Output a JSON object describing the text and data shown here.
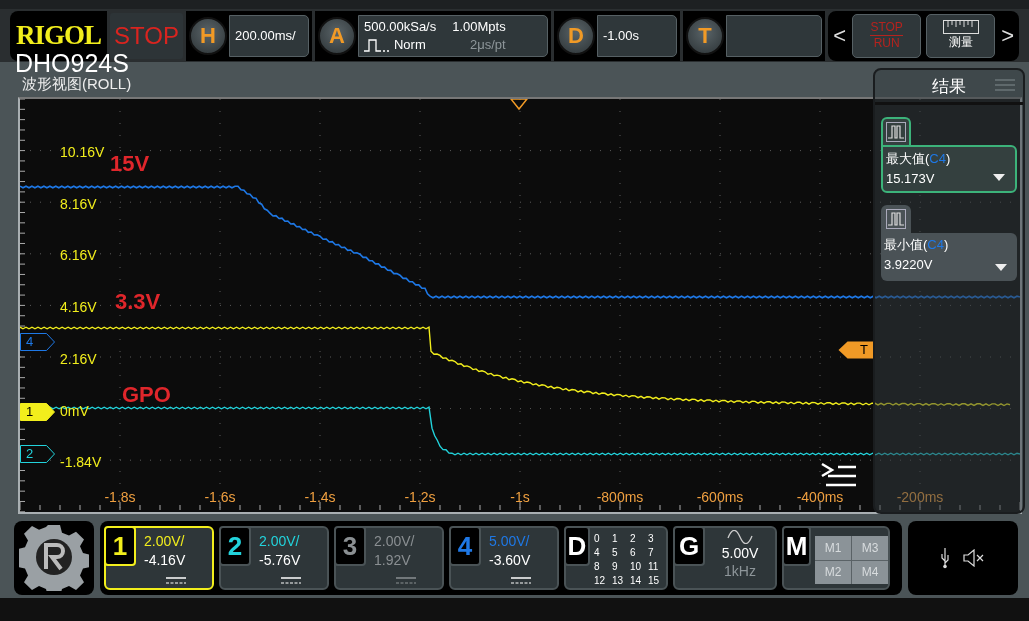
{
  "header": {
    "logo": "RIGOL",
    "run_state": "STOP",
    "model": "DHO924S",
    "horizontal": {
      "key": "H",
      "scale": "200.00ms/"
    },
    "acquire": {
      "key": "A",
      "sample_rate": "500.00kSa/s",
      "memory_depth": "1.00Mpts",
      "mode": "Norm",
      "time_per_point": "2μs/pt"
    },
    "delay": {
      "key": "D",
      "value": "-1.00s"
    },
    "trigger": {
      "key": "T"
    },
    "nav_prev": "<",
    "nav_next": ">",
    "quick_buttons": [
      {
        "kind": "stop-run",
        "top": "STOP",
        "bottom": "RUN"
      },
      {
        "kind": "measure",
        "label": "测量"
      }
    ]
  },
  "waveform_view": {
    "title": "波形视图(ROLL)",
    "y_labels": [
      "10.16V",
      "8.16V",
      "6.16V",
      "4.16V",
      "2.16V",
      "0mV",
      "-1.84V"
    ],
    "x_labels": [
      "-1.8s",
      "-1.6s",
      "-1.4s",
      "-1.2s",
      "-1s",
      "-800ms",
      "-600ms",
      "-400ms",
      "-200ms"
    ],
    "annotations": [
      "15V",
      "3.3V",
      "GPO"
    ],
    "channel_markers": [
      {
        "label": "4",
        "color": "#1e78e6",
        "filled": false
      },
      {
        "label": "1",
        "color": "#f2ee1c",
        "filled": true
      },
      {
        "label": "2",
        "color": "#22d3dc",
        "filled": false
      }
    ],
    "trigger_marker": "T"
  },
  "results_panel": {
    "title": "结果",
    "items": [
      {
        "label_prefix": "最大值(",
        "source": "C4",
        "label_suffix": ")",
        "value": "15.173V",
        "selected": true
      },
      {
        "label_prefix": "最小值(",
        "source": "C4",
        "label_suffix": ")",
        "value": "3.9220V",
        "selected": false
      }
    ]
  },
  "channels": [
    {
      "number": "1",
      "scale": "2.00V/",
      "offset": "-4.16V",
      "color": "#f2ee1c",
      "on": true,
      "selected": true
    },
    {
      "number": "2",
      "scale": "2.00V/",
      "offset": "-5.76V",
      "color": "#22d3dc",
      "on": true,
      "selected": false
    },
    {
      "number": "3",
      "scale": "2.00V/",
      "offset": "1.92V",
      "color": "#8a8f92",
      "on": false,
      "selected": false
    },
    {
      "number": "4",
      "scale": "5.00V/",
      "offset": "-3.60V",
      "color": "#1e78e6",
      "on": true,
      "selected": false
    }
  ],
  "digital": {
    "key": "D",
    "bits": [
      "0",
      "1",
      "2",
      "3",
      "4",
      "5",
      "6",
      "7",
      "8",
      "9",
      "10",
      "11",
      "12",
      "13",
      "14",
      "15"
    ]
  },
  "generator": {
    "key": "G",
    "amplitude": "5.00V",
    "frequency": "1kHz"
  },
  "math": {
    "key": "M",
    "items": [
      "M1",
      "M3",
      "M2",
      "M4"
    ]
  }
}
